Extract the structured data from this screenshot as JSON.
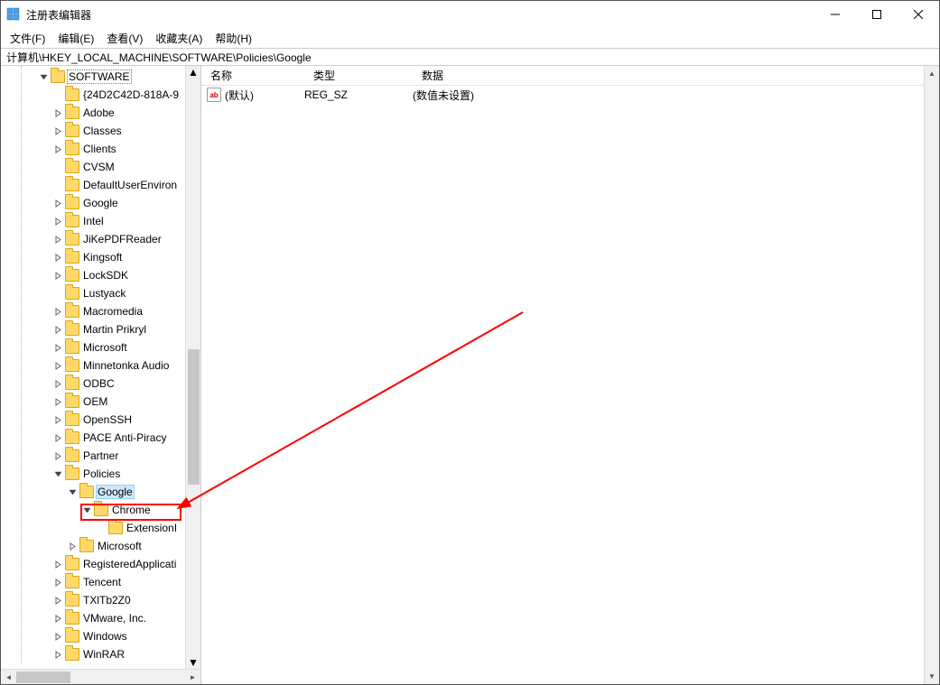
{
  "window": {
    "title": "注册表编辑器"
  },
  "menu": {
    "file": "文件(F)",
    "edit": "编辑(E)",
    "view": "查看(V)",
    "favorites": "收藏夹(A)",
    "help": "帮助(H)"
  },
  "address": {
    "path": "计算机\\HKEY_LOCAL_MACHINE\\SOFTWARE\\Policies\\Google"
  },
  "list": {
    "headers": {
      "name": "名称",
      "type": "类型",
      "data": "数据"
    },
    "rows": [
      {
        "name": "(默认)",
        "type": "REG_SZ",
        "data": "(数值未设置)"
      }
    ]
  },
  "tree": [
    {
      "indent": 2,
      "chev": "down",
      "label": "SOFTWARE",
      "focused": true
    },
    {
      "indent": 3,
      "chev": "blank",
      "label": "{24D2C42D-818A-9"
    },
    {
      "indent": 3,
      "chev": "right",
      "label": "Adobe"
    },
    {
      "indent": 3,
      "chev": "right",
      "label": "Classes"
    },
    {
      "indent": 3,
      "chev": "right",
      "label": "Clients"
    },
    {
      "indent": 3,
      "chev": "blank",
      "label": "CVSM"
    },
    {
      "indent": 3,
      "chev": "blank",
      "label": "DefaultUserEnviron"
    },
    {
      "indent": 3,
      "chev": "right",
      "label": "Google"
    },
    {
      "indent": 3,
      "chev": "right",
      "label": "Intel"
    },
    {
      "indent": 3,
      "chev": "right",
      "label": "JiKePDFReader"
    },
    {
      "indent": 3,
      "chev": "right",
      "label": "Kingsoft"
    },
    {
      "indent": 3,
      "chev": "right",
      "label": "LockSDK"
    },
    {
      "indent": 3,
      "chev": "blank",
      "label": "Lustyack"
    },
    {
      "indent": 3,
      "chev": "right",
      "label": "Macromedia"
    },
    {
      "indent": 3,
      "chev": "right",
      "label": "Martin Prikryl"
    },
    {
      "indent": 3,
      "chev": "right",
      "label": "Microsoft"
    },
    {
      "indent": 3,
      "chev": "right",
      "label": "Minnetonka Audio"
    },
    {
      "indent": 3,
      "chev": "right",
      "label": "ODBC"
    },
    {
      "indent": 3,
      "chev": "right",
      "label": "OEM"
    },
    {
      "indent": 3,
      "chev": "right",
      "label": "OpenSSH"
    },
    {
      "indent": 3,
      "chev": "right",
      "label": "PACE Anti-Piracy"
    },
    {
      "indent": 3,
      "chev": "right",
      "label": "Partner"
    },
    {
      "indent": 3,
      "chev": "down",
      "label": "Policies"
    },
    {
      "indent": 4,
      "chev": "down",
      "label": "Google",
      "selected": true
    },
    {
      "indent": 5,
      "chev": "down",
      "label": "Chrome"
    },
    {
      "indent": 6,
      "chev": "blank",
      "label": "ExtensionI"
    },
    {
      "indent": 4,
      "chev": "right",
      "label": "Microsoft"
    },
    {
      "indent": 3,
      "chev": "right",
      "label": "RegisteredApplicati"
    },
    {
      "indent": 3,
      "chev": "right",
      "label": "Tencent"
    },
    {
      "indent": 3,
      "chev": "right",
      "label": "TXlTb2Z0"
    },
    {
      "indent": 3,
      "chev": "right",
      "label": "VMware, Inc."
    },
    {
      "indent": 3,
      "chev": "right",
      "label": "Windows"
    },
    {
      "indent": 3,
      "chev": "right",
      "label": "WinRAR"
    }
  ]
}
